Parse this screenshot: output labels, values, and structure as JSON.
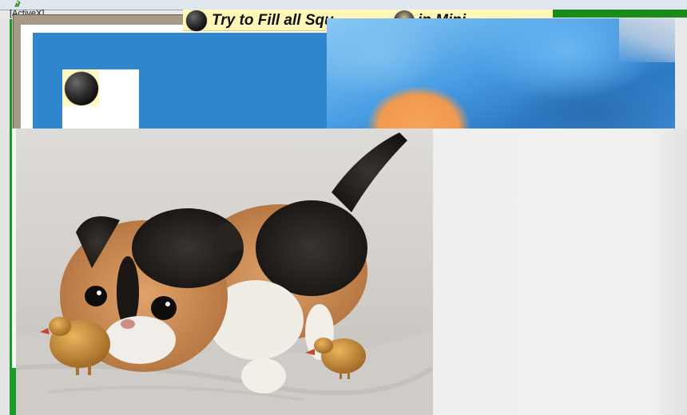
{
  "window": {
    "control_label": "[ActiveX]"
  },
  "game": {
    "title_left": "Try to Fill all Squ",
    "title_right": "in Mini"
  },
  "icons": {
    "app": "activex-control-icon",
    "ball": "black-ball-icon"
  },
  "colors": {
    "board_blue": "#2f86cc",
    "banner_yellow": "#fff6b8",
    "accent_green": "#1a9a2a"
  }
}
